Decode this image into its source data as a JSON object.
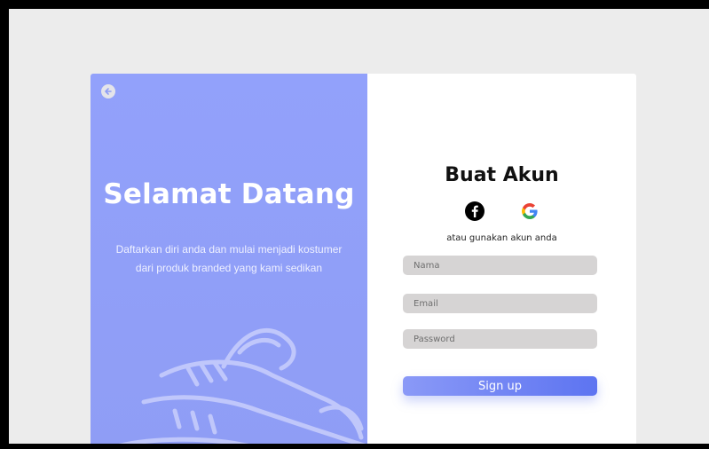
{
  "left": {
    "title": "Selamat Datang",
    "subtitle_line1": "Daftarkan diri anda dan mulai menjadi kostumer",
    "subtitle_line2": "dari produk branded yang kami sedikan",
    "back_icon": "arrow-left-icon",
    "illustration_icon": "shoe-illustration"
  },
  "form": {
    "title": "Buat Akun",
    "social_icons": [
      "facebook-icon",
      "google-icon"
    ],
    "alt_text": "atau gunakan akun anda",
    "name_placeholder": "Nama",
    "email_placeholder": "Email",
    "password_placeholder": "Password",
    "signup_label": "Sign up"
  },
  "colors": {
    "panel_accent": "#92a1fb",
    "button_start": "#8a99f7",
    "button_end": "#5d74f1",
    "field_bg": "#d6d4d4"
  }
}
